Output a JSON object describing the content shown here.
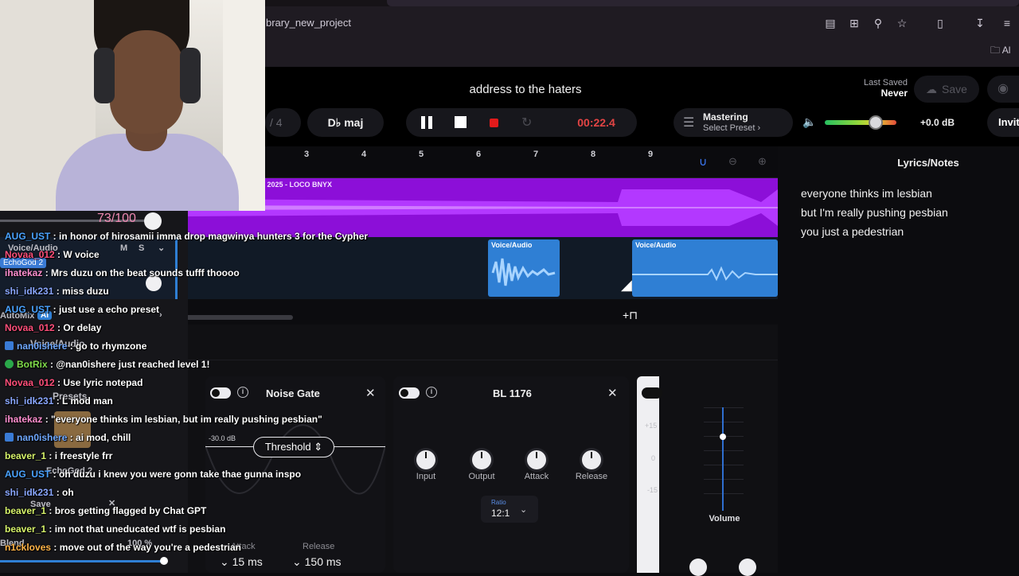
{
  "browser": {
    "url": "brary_new_project",
    "bookmark_label": "Al"
  },
  "header": {
    "project_title": "address to the haters",
    "last_saved_label": "Last Saved",
    "last_saved_value": "Never",
    "save_label": "Save",
    "bars_label": "/ 4",
    "key_label": "D♭ maj",
    "time": "00:22.4",
    "mastering_label": "Mastering",
    "mastering_preset": "Select Preset ›",
    "volume_db": "+0.0 dB",
    "volume_level": 0.71,
    "invite_label": "Invit"
  },
  "timeline": {
    "ticks": [
      "3",
      "4",
      "5",
      "6",
      "7",
      "8",
      "9"
    ],
    "track1_label": "t 2025 - LOCO  BNYX",
    "clip_labels": [
      "Voice/Audio",
      "Voice/Audio"
    ]
  },
  "lyrics": {
    "title": "Lyrics/Notes",
    "lines": [
      "everyone thinks im lesbian",
      "but I'm really pushing pesbian",
      "you just a pedestrian"
    ]
  },
  "effects": {
    "noise_gate": {
      "title": "Noise Gate",
      "db_label": "-30.0 dB",
      "threshold_label": "Threshold",
      "attack_label": "Attack",
      "attack_value": "15 ms",
      "release_label": "Release",
      "release_value": "150 ms"
    },
    "bl1176": {
      "title": "BL 1176",
      "knobs": [
        "Input",
        "Output",
        "Attack",
        "Release"
      ],
      "ratio_label": "Ratio",
      "ratio_value": "12:1"
    },
    "volume_label": "Volume",
    "scale": [
      "+15",
      "0",
      "-15"
    ]
  },
  "overlay": {
    "score": "73/100",
    "track_name": "Voice/Audio",
    "track_name2": "Voice/Audio",
    "ms_labels": [
      "M",
      "S"
    ],
    "echo_label": "EchoGod 2",
    "automix_label": "AutoMix",
    "ai_label": "AI",
    "presets_label": "Presets",
    "echo_label2": "EchoGod 2",
    "save_label": "Save",
    "blend_label": "Blend",
    "blend_value": "100 %"
  },
  "chat": [
    {
      "user": "AUG_UST",
      "color": "#4aa3ff",
      "text": " : in honor of hirosamii imma drop magwinya hunters 3 for the Cypher"
    },
    {
      "user": "Novaa_012",
      "color": "#ff4f7a",
      "text": " : W voice"
    },
    {
      "user": "ihatekaz",
      "color": "#ff8fd0",
      "text": " : Mrs duzu on the beat sounds tufff thoooo"
    },
    {
      "user": "shi_idk231",
      "color": "#8aa7ff",
      "text": " : miss duzu"
    },
    {
      "user": "AUG_UST",
      "color": "#4aa3ff",
      "text": " : just use a echo preset"
    },
    {
      "user": "Novaa_012",
      "color": "#ff4f7a",
      "text": " : Or delay"
    },
    {
      "user": "nan0ishere",
      "color": "#6fa8ff",
      "text": " : go to rhymzone"
    },
    {
      "user": "BotRix",
      "color": "#7fdc4a",
      "text": " : @nan0ishere just reached level 1!"
    },
    {
      "user": "Novaa_012",
      "color": "#ff4f7a",
      "text": " : Use lyric notepad"
    },
    {
      "user": "shi_idk231",
      "color": "#8aa7ff",
      "text": " : L mod man"
    },
    {
      "user": "ihatekaz",
      "color": "#ff8fd0",
      "text": " : \"everyone thinks im lesbian, but im really pushing pesbian\""
    },
    {
      "user": "nan0ishere",
      "color": "#6fa8ff",
      "text": " : ai mod, chill"
    },
    {
      "user": "beaver_1",
      "color": "#d6f26a",
      "text": " : i freestyle frr"
    },
    {
      "user": "AUG_UST",
      "color": "#4aa3ff",
      "text": " : oh duzu i knew you were gonn take thae gunna inspo"
    },
    {
      "user": "shi_idk231",
      "color": "#8aa7ff",
      "text": " : oh"
    },
    {
      "user": "beaver_1",
      "color": "#d6f26a",
      "text": " : bros getting flagged by Chat GPT"
    },
    {
      "user": "beaver_1",
      "color": "#d6f26a",
      "text": " : im not that uneducated wtf is pesbian"
    },
    {
      "user": "n1ckloves",
      "color": "#ffb347",
      "text": " : move out of the way you're a pedestrian"
    }
  ]
}
